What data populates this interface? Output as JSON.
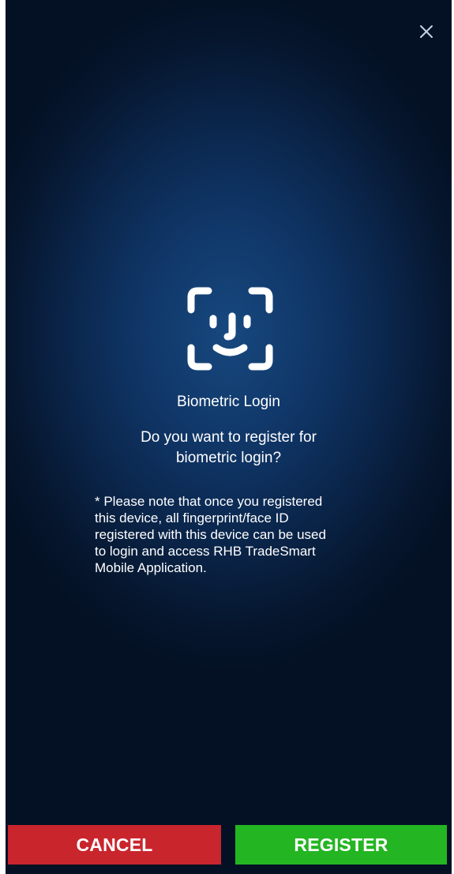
{
  "header": {
    "close_icon": "close-icon"
  },
  "dialog": {
    "icon": "face-id-icon",
    "title": "Biometric Login",
    "question_line1": "Do you want to register for",
    "question_line2": "biometric login?",
    "note_lines": [
      "* Please note that once you registered",
      "this device, all fingerprint/face ID",
      "registered with this device can be used",
      "to login and access RHB TradeSmart",
      "Mobile Application."
    ]
  },
  "actions": {
    "cancel_label": "CANCEL",
    "register_label": "REGISTER"
  },
  "colors": {
    "background_center": "#17487f",
    "background_edge": "#041124",
    "cancel": "#c9252d",
    "register": "#24b522",
    "text": "#ffffff"
  }
}
